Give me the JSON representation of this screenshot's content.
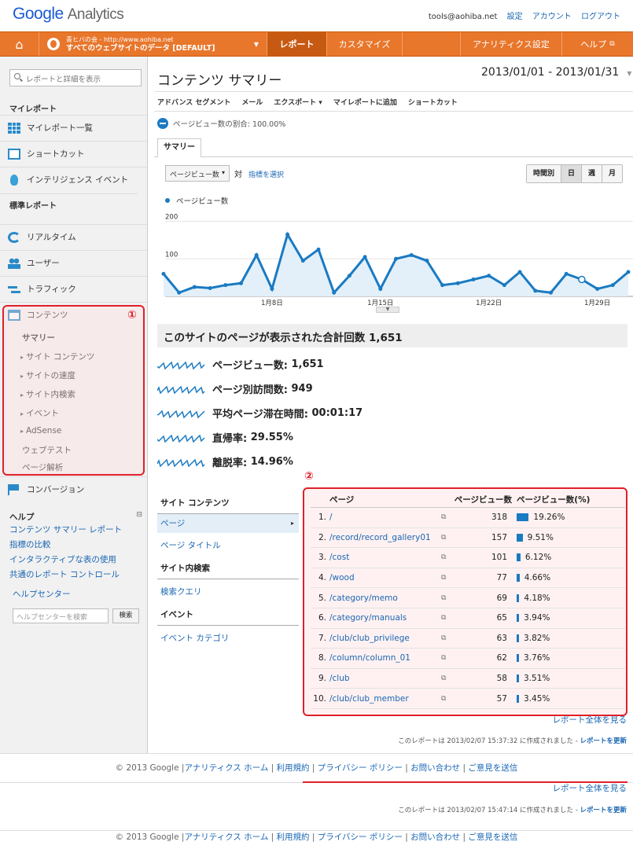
{
  "header": {
    "logo_google": "Google",
    "logo_product": "Analytics",
    "email": "tools@aohiba.net",
    "links": [
      "設定",
      "アカウント",
      "ログアウト"
    ]
  },
  "nav": {
    "account_line1": "青ヒバの会 - http://www.aohiba.net",
    "account_line2": "すべてのウェブサイトのデータ [DEFAULT]",
    "tabs": {
      "report": "レポート",
      "customize": "カスタマイズ",
      "admin": "アナリティクス設定",
      "help": "ヘルプ"
    }
  },
  "sidebar": {
    "search_placeholder": "レポートと詳細を表示",
    "my_reports": "マイレポート",
    "my_items": [
      "マイレポート一覧",
      "ショートカット",
      "インテリジェンス イベント"
    ],
    "standard_reports": "標準レポート",
    "std_items": [
      "リアルタイム",
      "ユーザー",
      "トラフィック",
      "コンテンツ"
    ],
    "content_sub": [
      "サマリー",
      "サイト コンテンツ",
      "サイトの速度",
      "サイト内検索",
      "イベント",
      "AdSense",
      "ウェブテスト",
      "ページ解析"
    ],
    "conversion": "コンバージョン",
    "help_title": "ヘルプ",
    "help_links": [
      "コンテンツ サマリー レポート",
      "指標の比較",
      "インタラクティブな表の使用",
      "共通のレポート コントロール"
    ],
    "help_center": "ヘルプセンター",
    "help_search_placeholder": "ヘルプセンターを検索",
    "help_search_btn": "検索",
    "marker1": "①"
  },
  "main": {
    "title": "コンテンツ サマリー",
    "date_range": "2013/01/01 - 2013/01/31",
    "toolbar": [
      "アドバンス セグメント",
      "メール",
      "エクスポート ▾",
      "マイレポートに追加",
      "ショートカット"
    ],
    "pct_text": "ページビュー数の割合: 100.00%",
    "summary_tab": "サマリー",
    "metric_select": "ページビュー数",
    "vs": "対",
    "select_metric": "指標を選択",
    "granularity": [
      "時間別",
      "日",
      "週",
      "月"
    ],
    "legend": "ページビュー数",
    "total_label": "このサイトのページが表示された合計回数",
    "total_value": "1,651",
    "stats": [
      {
        "label": "ページビュー数:",
        "value": "1,651"
      },
      {
        "label": "ページ別訪問数:",
        "value": "949"
      },
      {
        "label": "平均ページ滞在時間:",
        "value": "00:01:17"
      },
      {
        "label": "直帰率:",
        "value": "29.55%"
      },
      {
        "label": "離脱率:",
        "value": "14.96%"
      }
    ],
    "side_content": {
      "h1": "サイト コンテンツ",
      "sel": "ページ",
      "l1": "ページ タイトル",
      "h2": "サイト内検索",
      "l2": "検索クエリ",
      "h3": "イベント",
      "l3": "イベント カテゴリ"
    },
    "marker2": "②",
    "table": {
      "headers": [
        "ページ",
        "ページビュー数",
        "ページビュー数(%)"
      ],
      "rows": [
        {
          "no": "1.",
          "page": "/",
          "pv": "318",
          "pct": "19.26%",
          "frac": 0.1926
        },
        {
          "no": "2.",
          "page": "/record/record_gallery01",
          "pv": "157",
          "pct": "9.51%",
          "frac": 0.0951
        },
        {
          "no": "3.",
          "page": "/cost",
          "pv": "101",
          "pct": "6.12%",
          "frac": 0.0612
        },
        {
          "no": "4.",
          "page": "/wood",
          "pv": "77",
          "pct": "4.66%",
          "frac": 0.0466
        },
        {
          "no": "5.",
          "page": "/category/memo",
          "pv": "69",
          "pct": "4.18%",
          "frac": 0.0418
        },
        {
          "no": "6.",
          "page": "/category/manuals",
          "pv": "65",
          "pct": "3.94%",
          "frac": 0.0394
        },
        {
          "no": "7.",
          "page": "/club/club_privilege",
          "pv": "63",
          "pct": "3.82%",
          "frac": 0.0382
        },
        {
          "no": "8.",
          "page": "/column/column_01",
          "pv": "62",
          "pct": "3.76%",
          "frac": 0.0376
        },
        {
          "no": "9.",
          "page": "/club",
          "pv": "58",
          "pct": "3.51%",
          "frac": 0.0351
        },
        {
          "no": "10.",
          "page": "/club/club_member",
          "pv": "57",
          "pct": "3.45%",
          "frac": 0.0345
        }
      ]
    },
    "full_report": "レポート全体を見る",
    "generated1": "このレポートは 2013/02/07 15:37:32 に作成されました -",
    "generated2": "このレポートは 2013/02/07 15:47:14 に作成されました -",
    "refresh": "レポートを更新"
  },
  "footer": {
    "copy": "© 2013 Google |",
    "links": [
      "アナリティクス ホーム",
      "利用規約",
      "プライバシー ポリシー",
      "お問い合わせ",
      "ご意見を送信"
    ]
  },
  "chart_data": {
    "type": "area",
    "x_tick_labels": [
      "1月8日",
      "1月15日",
      "1月22日",
      "1月29日"
    ],
    "y_tick_labels": [
      "200",
      "100"
    ],
    "ylim": [
      0,
      220
    ],
    "series": [
      {
        "name": "ページビュー数",
        "values": [
          60,
          10,
          25,
          22,
          30,
          35,
          110,
          20,
          165,
          95,
          125,
          10,
          55,
          105,
          20,
          100,
          110,
          95,
          30,
          35,
          45,
          55,
          30,
          65,
          15,
          10,
          60,
          45,
          20,
          30,
          65
        ]
      }
    ],
    "color": "#1a7ac2"
  }
}
